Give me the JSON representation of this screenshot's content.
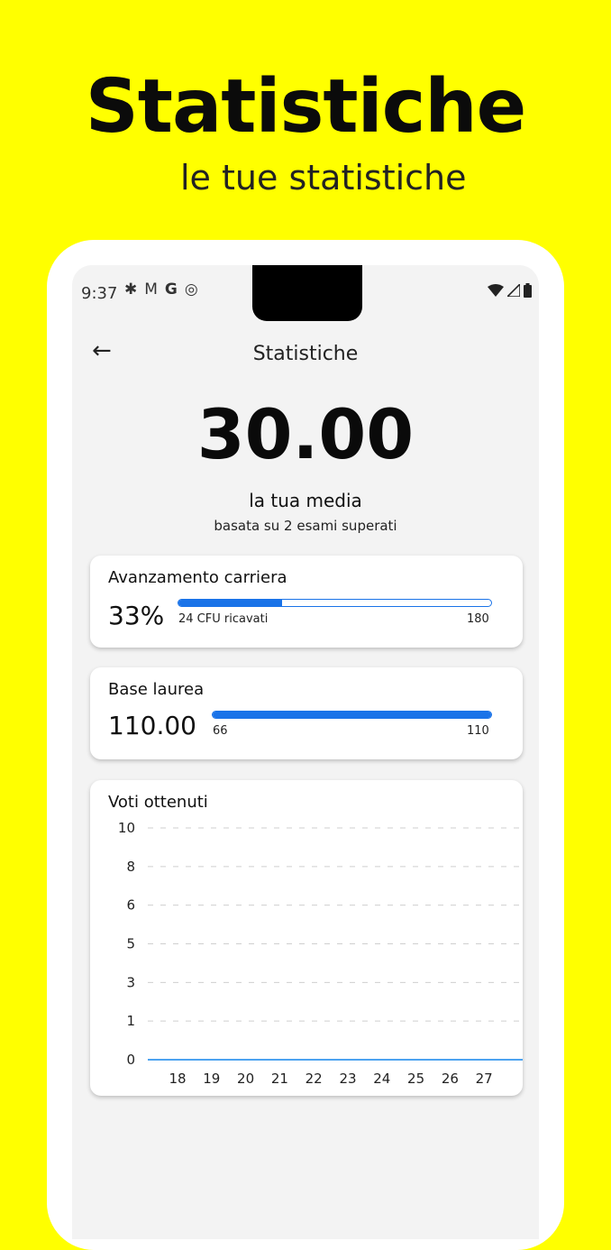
{
  "promo": {
    "title": "Statistiche",
    "subtitle": "le tue statistiche"
  },
  "status_bar": {
    "time": "9:37",
    "left_icons": [
      "gear-icon",
      "gmail-icon",
      "google-icon",
      "vpn-icon"
    ],
    "right_icons": [
      "wifi-icon",
      "signal-icon",
      "battery-icon"
    ]
  },
  "app_bar": {
    "title": "Statistiche"
  },
  "average": {
    "value": "30.00",
    "label": "la tua media",
    "sub": "basata su 2 esami superati"
  },
  "career": {
    "title": "Avanzamento carriera",
    "percent": "33%",
    "progress_label": "24 CFU ricavati",
    "max_label": "180",
    "progress_fraction": 0.33
  },
  "base": {
    "title": "Base laurea",
    "value": "110.00",
    "min_label": "66",
    "max_label": "110",
    "progress_fraction": 1.0
  },
  "chart_data": {
    "type": "line",
    "title": "Voti ottenuti",
    "x": [
      "18",
      "19",
      "20",
      "21",
      "22",
      "23",
      "24",
      "25",
      "26",
      "27"
    ],
    "y_ticks": [
      "10",
      "8",
      "6",
      "5",
      "3",
      "1",
      "0"
    ],
    "series": [
      {
        "values": [
          0,
          0,
          0,
          0,
          0,
          0,
          0,
          0,
          0,
          0
        ]
      }
    ],
    "ylim": [
      0,
      10
    ],
    "grid": true,
    "line_color": "#4da3f0"
  },
  "colors": {
    "background": "#FFFF00",
    "accent": "#1a73e8"
  }
}
